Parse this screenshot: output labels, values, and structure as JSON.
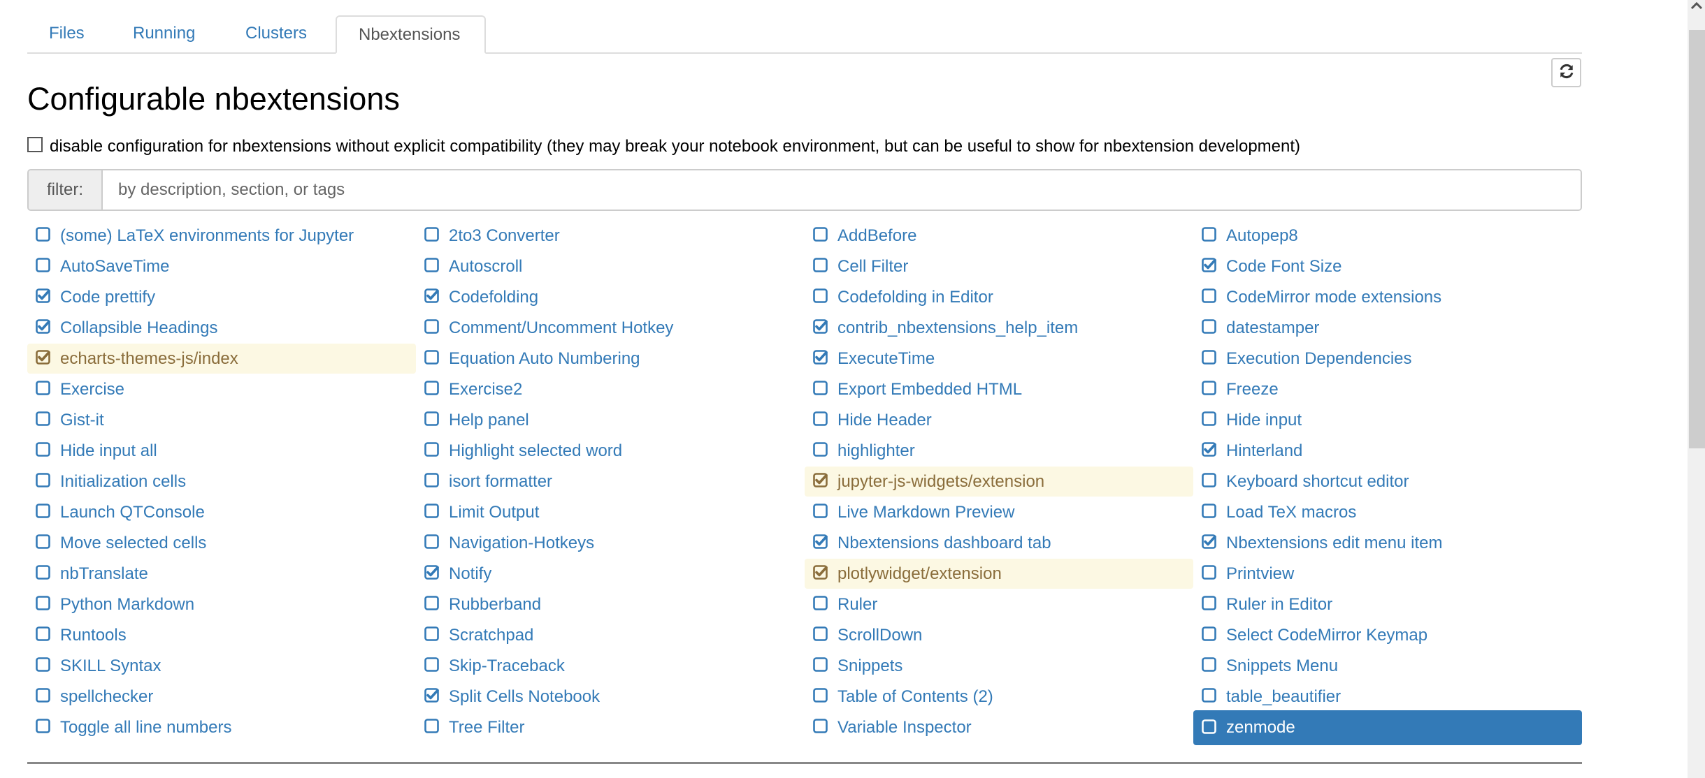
{
  "tabs": [
    {
      "label": "Files",
      "active": false
    },
    {
      "label": "Running",
      "active": false
    },
    {
      "label": "Clusters",
      "active": false
    },
    {
      "label": "Nbextensions",
      "active": true
    }
  ],
  "page_title": "Configurable nbextensions",
  "refresh_icon": "refresh-icon",
  "disable_option": {
    "checked": false,
    "label": "disable configuration for nbextensions without explicit compatibility (they may break your notebook environment, but can be useful to show for nbextension development)"
  },
  "filter": {
    "label": "filter:",
    "value": "",
    "placeholder": "by description, section, or tags"
  },
  "colors": {
    "link": "#337ab7",
    "warning_bg": "#fcf8e3",
    "warning_text": "#8a6d3b",
    "selected_bg": "#337ab7"
  },
  "extensions": [
    {
      "label": "(some) LaTeX environments for Jupyter",
      "checked": false,
      "state": "normal"
    },
    {
      "label": "2to3 Converter",
      "checked": false,
      "state": "normal"
    },
    {
      "label": "AddBefore",
      "checked": false,
      "state": "normal"
    },
    {
      "label": "Autopep8",
      "checked": false,
      "state": "normal"
    },
    {
      "label": "AutoSaveTime",
      "checked": false,
      "state": "normal"
    },
    {
      "label": "Autoscroll",
      "checked": false,
      "state": "normal"
    },
    {
      "label": "Cell Filter",
      "checked": false,
      "state": "normal"
    },
    {
      "label": "Code Font Size",
      "checked": true,
      "state": "normal"
    },
    {
      "label": "Code prettify",
      "checked": true,
      "state": "normal"
    },
    {
      "label": "Codefolding",
      "checked": true,
      "state": "normal"
    },
    {
      "label": "Codefolding in Editor",
      "checked": false,
      "state": "normal"
    },
    {
      "label": "CodeMirror mode extensions",
      "checked": false,
      "state": "normal"
    },
    {
      "label": "Collapsible Headings",
      "checked": true,
      "state": "normal"
    },
    {
      "label": "Comment/Uncomment Hotkey",
      "checked": false,
      "state": "normal"
    },
    {
      "label": "contrib_nbextensions_help_item",
      "checked": true,
      "state": "normal"
    },
    {
      "label": "datestamper",
      "checked": false,
      "state": "normal"
    },
    {
      "label": "echarts-themes-js/index",
      "checked": true,
      "state": "warning"
    },
    {
      "label": "Equation Auto Numbering",
      "checked": false,
      "state": "normal"
    },
    {
      "label": "ExecuteTime",
      "checked": true,
      "state": "normal"
    },
    {
      "label": "Execution Dependencies",
      "checked": false,
      "state": "normal"
    },
    {
      "label": "Exercise",
      "checked": false,
      "state": "normal"
    },
    {
      "label": "Exercise2",
      "checked": false,
      "state": "normal"
    },
    {
      "label": "Export Embedded HTML",
      "checked": false,
      "state": "normal"
    },
    {
      "label": "Freeze",
      "checked": false,
      "state": "normal"
    },
    {
      "label": "Gist-it",
      "checked": false,
      "state": "normal"
    },
    {
      "label": "Help panel",
      "checked": false,
      "state": "normal"
    },
    {
      "label": "Hide Header",
      "checked": false,
      "state": "normal"
    },
    {
      "label": "Hide input",
      "checked": false,
      "state": "normal"
    },
    {
      "label": "Hide input all",
      "checked": false,
      "state": "normal"
    },
    {
      "label": "Highlight selected word",
      "checked": false,
      "state": "normal"
    },
    {
      "label": "highlighter",
      "checked": false,
      "state": "normal"
    },
    {
      "label": "Hinterland",
      "checked": true,
      "state": "normal"
    },
    {
      "label": "Initialization cells",
      "checked": false,
      "state": "normal"
    },
    {
      "label": "isort formatter",
      "checked": false,
      "state": "normal"
    },
    {
      "label": "jupyter-js-widgets/extension",
      "checked": true,
      "state": "warning"
    },
    {
      "label": "Keyboard shortcut editor",
      "checked": false,
      "state": "normal"
    },
    {
      "label": "Launch QTConsole",
      "checked": false,
      "state": "normal"
    },
    {
      "label": "Limit Output",
      "checked": false,
      "state": "normal"
    },
    {
      "label": "Live Markdown Preview",
      "checked": false,
      "state": "normal"
    },
    {
      "label": "Load TeX macros",
      "checked": false,
      "state": "normal"
    },
    {
      "label": "Move selected cells",
      "checked": false,
      "state": "normal"
    },
    {
      "label": "Navigation-Hotkeys",
      "checked": false,
      "state": "normal"
    },
    {
      "label": "Nbextensions dashboard tab",
      "checked": true,
      "state": "normal"
    },
    {
      "label": "Nbextensions edit menu item",
      "checked": true,
      "state": "normal"
    },
    {
      "label": "nbTranslate",
      "checked": false,
      "state": "normal"
    },
    {
      "label": "Notify",
      "checked": true,
      "state": "normal"
    },
    {
      "label": "plotlywidget/extension",
      "checked": true,
      "state": "warning"
    },
    {
      "label": "Printview",
      "checked": false,
      "state": "normal"
    },
    {
      "label": "Python Markdown",
      "checked": false,
      "state": "normal"
    },
    {
      "label": "Rubberband",
      "checked": false,
      "state": "normal"
    },
    {
      "label": "Ruler",
      "checked": false,
      "state": "normal"
    },
    {
      "label": "Ruler in Editor",
      "checked": false,
      "state": "normal"
    },
    {
      "label": "Runtools",
      "checked": false,
      "state": "normal"
    },
    {
      "label": "Scratchpad",
      "checked": false,
      "state": "normal"
    },
    {
      "label": "ScrollDown",
      "checked": false,
      "state": "normal"
    },
    {
      "label": "Select CodeMirror Keymap",
      "checked": false,
      "state": "normal"
    },
    {
      "label": "SKILL Syntax",
      "checked": false,
      "state": "normal"
    },
    {
      "label": "Skip-Traceback",
      "checked": false,
      "state": "normal"
    },
    {
      "label": "Snippets",
      "checked": false,
      "state": "normal"
    },
    {
      "label": "Snippets Menu",
      "checked": false,
      "state": "normal"
    },
    {
      "label": "spellchecker",
      "checked": false,
      "state": "normal"
    },
    {
      "label": "Split Cells Notebook",
      "checked": true,
      "state": "normal"
    },
    {
      "label": "Table of Contents (2)",
      "checked": false,
      "state": "normal"
    },
    {
      "label": "table_beautifier",
      "checked": false,
      "state": "normal"
    },
    {
      "label": "Toggle all line numbers",
      "checked": false,
      "state": "normal"
    },
    {
      "label": "Tree Filter",
      "checked": false,
      "state": "normal"
    },
    {
      "label": "Variable Inspector",
      "checked": false,
      "state": "normal"
    },
    {
      "label": "zenmode",
      "checked": false,
      "state": "selected"
    }
  ],
  "scrollbar": {
    "position_fraction": 0.0
  }
}
